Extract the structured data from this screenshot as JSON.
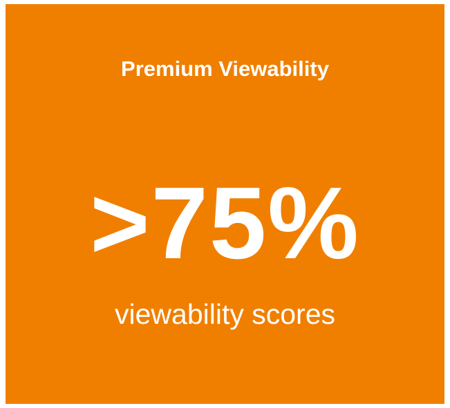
{
  "card": {
    "heading": "Premium Viewability",
    "stat": ">75%",
    "caption": "viewability scores",
    "background_color": "#f07f00",
    "text_color": "#ffffff"
  }
}
